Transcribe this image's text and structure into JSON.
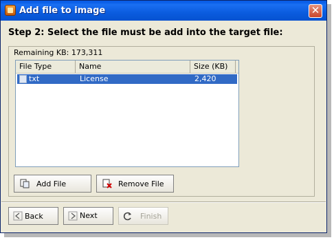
{
  "window": {
    "title": "Add file to image",
    "close_label": "✕"
  },
  "step_text": "Step 2: Select the file must be add into the target file:",
  "remaining_text": "Remaining KB: 173,311",
  "list": {
    "columns": [
      "File Type",
      "Name",
      "Size (KB)"
    ],
    "rows": [
      {
        "type": "txt",
        "name": "License",
        "size": "2,420",
        "selected": true
      }
    ]
  },
  "buttons": {
    "add_file": "Add File",
    "remove_file": "Remove File",
    "back": "Back",
    "next": "Next",
    "finish": "Finish"
  },
  "colors": {
    "titlebar": "#0a5ee8",
    "selection": "#316ac5",
    "dialog_bg": "#ece9d8"
  }
}
